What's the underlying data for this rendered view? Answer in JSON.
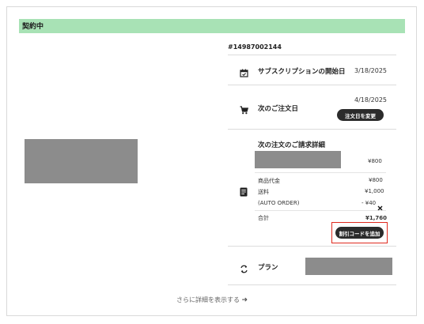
{
  "status": {
    "label": "契約中",
    "color": "#a8e2b5"
  },
  "order": {
    "id": "#14987002144"
  },
  "subscription": {
    "icon": "calendar-icon",
    "label": "サブスクリプションの開始日",
    "date": "3/18/2025"
  },
  "next_order": {
    "icon": "cart-icon",
    "label": "次のご注文日",
    "date": "4/18/2025",
    "change_button": "注文日を変更"
  },
  "billing": {
    "icon": "document-icon",
    "title": "次の注文のご請求詳細",
    "item_price": "¥800",
    "lines": [
      {
        "label": "商品代金",
        "value": "¥800"
      },
      {
        "label": "送料",
        "value": "¥1,000"
      },
      {
        "label": "(AUTO ORDER)",
        "value": "- ¥40"
      }
    ],
    "total_label": "合計",
    "total_value": "¥1,760",
    "discount_button": "割引コードを追加"
  },
  "plan": {
    "icon": "sync-icon",
    "label": "プラン"
  },
  "more_link": "さらに詳細を表示する",
  "highlight_color": "#e02a1e"
}
